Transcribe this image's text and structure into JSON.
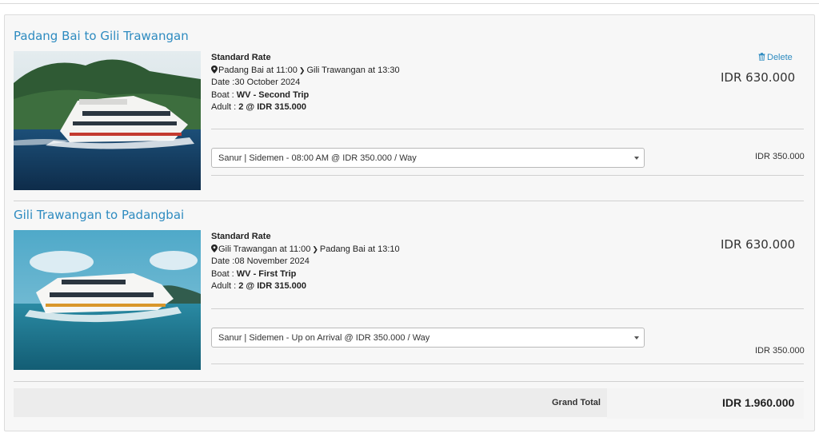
{
  "trips": [
    {
      "title": "Padang Bai to Gili Trawangan",
      "rate_name": "Standard Rate",
      "route_from": "Padang Bai at 11:00",
      "route_to": "Gili Trawangan at 13:30",
      "date": "Date :30 October 2024",
      "boat_label": "Boat : ",
      "boat_name": "WV - Second Trip",
      "adult_label": "Adult : ",
      "adult_value": "2 @ IDR 315.000",
      "price": "IDR 630.000",
      "delete_label": "Delete",
      "transfer_selected": "Sanur | Sidemen - 08:00 AM @ IDR 350.000 / Way",
      "transfer_price": "IDR 350.000"
    },
    {
      "title": "Gili Trawangan to Padangbai",
      "rate_name": "Standard Rate",
      "route_from": "Gili Trawangan at 11:00",
      "route_to": "Padang Bai at 13:10",
      "date": "Date :08 November 2024",
      "boat_label": "Boat : ",
      "boat_name": "WV - First Trip",
      "adult_label": "Adult : ",
      "adult_value": "2 @ IDR 315.000",
      "price": "IDR 630.000",
      "transfer_selected": "Sanur | Sidemen - Up on Arrival @ IDR 350.000 / Way",
      "transfer_price": "IDR 350.000"
    }
  ],
  "grand_total": {
    "label": "Grand Total",
    "value": "IDR 1.960.000"
  },
  "icons": {
    "pin": "map-marker-icon",
    "trash": "trash-icon",
    "route_arrow": "chevron-right-icon",
    "select_caret": "caret-down-icon"
  },
  "colors": {
    "link": "#2e8bc0",
    "panel_bg": "#f7f7f7",
    "total_bar": "#ececec"
  }
}
